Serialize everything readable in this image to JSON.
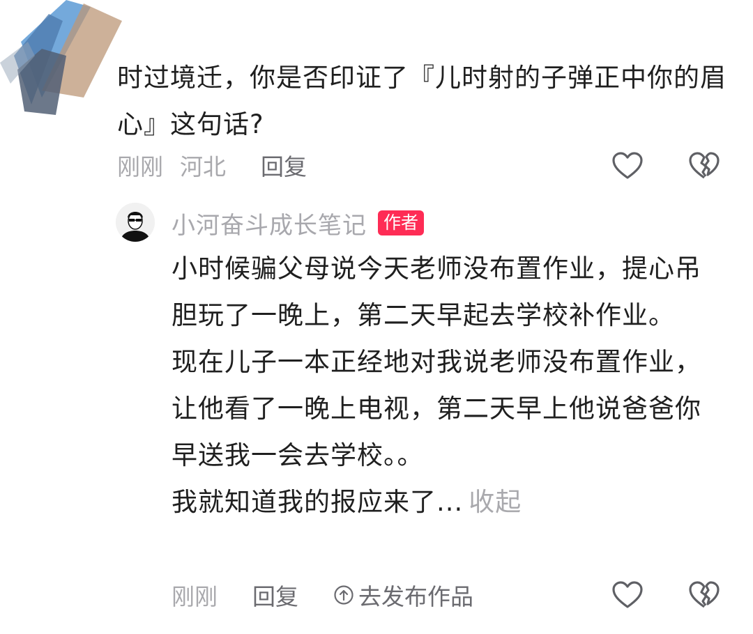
{
  "comment": {
    "text": "时过境迁，你是否印证了『儿时射的子弹正中你的眉心』这句话?",
    "time": "刚刚",
    "location": "河北",
    "reply_label": "回复"
  },
  "reply": {
    "username": "小河奋斗成长笔记",
    "author_badge": "作者",
    "paragraphs": [
      "小时候骗父母说今天老师没布置作业，提心吊胆玩了一晚上，第二天早起去学校补作业。",
      "现在儿子一本正经地对我说老师没布置作业，让他看了一晚上电视，第二天早上他说爸爸你早送我一会去学校。。"
    ],
    "last_line": "我就知道我的报应来了...",
    "collapse_label": "收起",
    "time": "刚刚",
    "reply_label": "回复",
    "publish_label": "去发布作品"
  },
  "colors": {
    "badge": "#fe2c55",
    "meta_text": "#a9a9ad",
    "body_text": "#1f1f1f"
  },
  "icons": {
    "like": "heart-outline-icon",
    "dislike": "broken-heart-icon",
    "publish": "up-arrow-circle-icon"
  }
}
